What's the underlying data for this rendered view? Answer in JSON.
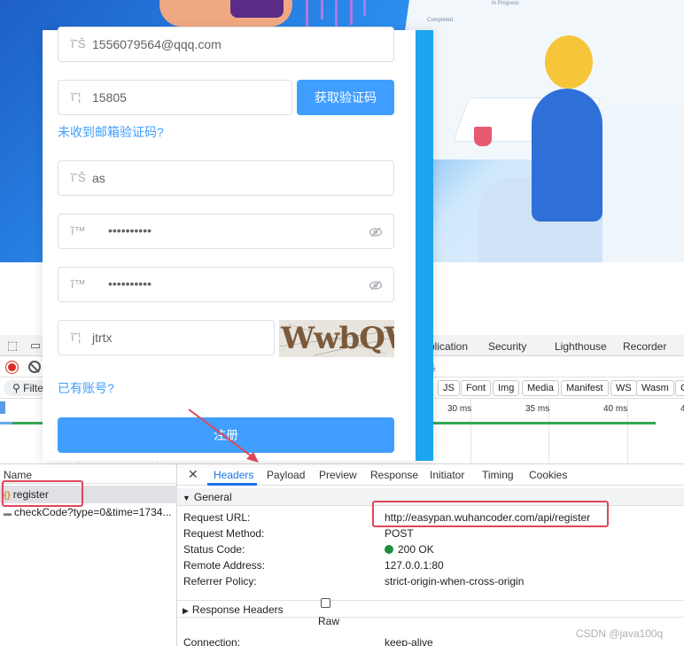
{
  "background": {
    "status_completed": "Completed",
    "status_in_progress": "In Progress"
  },
  "form": {
    "email_value": "1556079564@qqq.com",
    "email_code_value": "15805",
    "get_code_button": "获取验证码",
    "no_email_code_link": "未收到邮箱验证码?",
    "nickname_value": "as",
    "password_mask": "••••••••••",
    "confirm_password_mask": "••••••••••",
    "captcha_value": "jtrtx",
    "captcha_image_text": "WwbQW",
    "have_account_link": "已有账号?",
    "register_button": "注册",
    "icon_glyph_user": "ĩ˜Š",
    "icon_glyph_code": "ĩ˜¦",
    "icon_glyph_lock": "ĩ™"
  },
  "devtools": {
    "panel_tabs": [
      "plication",
      "Security",
      "Lighthouse",
      "Recorder"
    ],
    "filter_label": "Filte",
    "type_chips": [
      "JS",
      "Font",
      "Img",
      "Media",
      "Manifest",
      "WS",
      "Wasm",
      "C"
    ],
    "timeline_ticks": [
      "30 ms",
      "35 ms",
      "40 ms",
      "4"
    ],
    "list_header": "Name",
    "requests": [
      {
        "name": "register",
        "type": "xhr"
      },
      {
        "name": "checkCode?type=0&time=1734...",
        "type": "doc"
      }
    ],
    "detail_tabs": [
      "Headers",
      "Payload",
      "Preview",
      "Response",
      "Initiator",
      "Timing",
      "Cookies"
    ],
    "general_title": "General",
    "general": [
      {
        "key": "Request URL:",
        "value": "http://easypan.wuhancoder.com/api/register"
      },
      {
        "key": "Request Method:",
        "value": "POST"
      },
      {
        "key": "Status Code:",
        "value": "200 OK"
      },
      {
        "key": "Remote Address:",
        "value": "127.0.0.1:80"
      },
      {
        "key": "Referrer Policy:",
        "value": "strict-origin-when-cross-origin"
      }
    ],
    "response_headers_title": "Response Headers",
    "raw_label": "Raw",
    "response_headers": [
      {
        "key": "Connection:",
        "value": "keep-alive"
      }
    ]
  },
  "watermark": "CSDN @java100q",
  "colors": {
    "primary": "#409eff",
    "accent_red": "#e0465a",
    "status_green": "#1e8e3e",
    "devtools_blue": "#1a73e8"
  }
}
